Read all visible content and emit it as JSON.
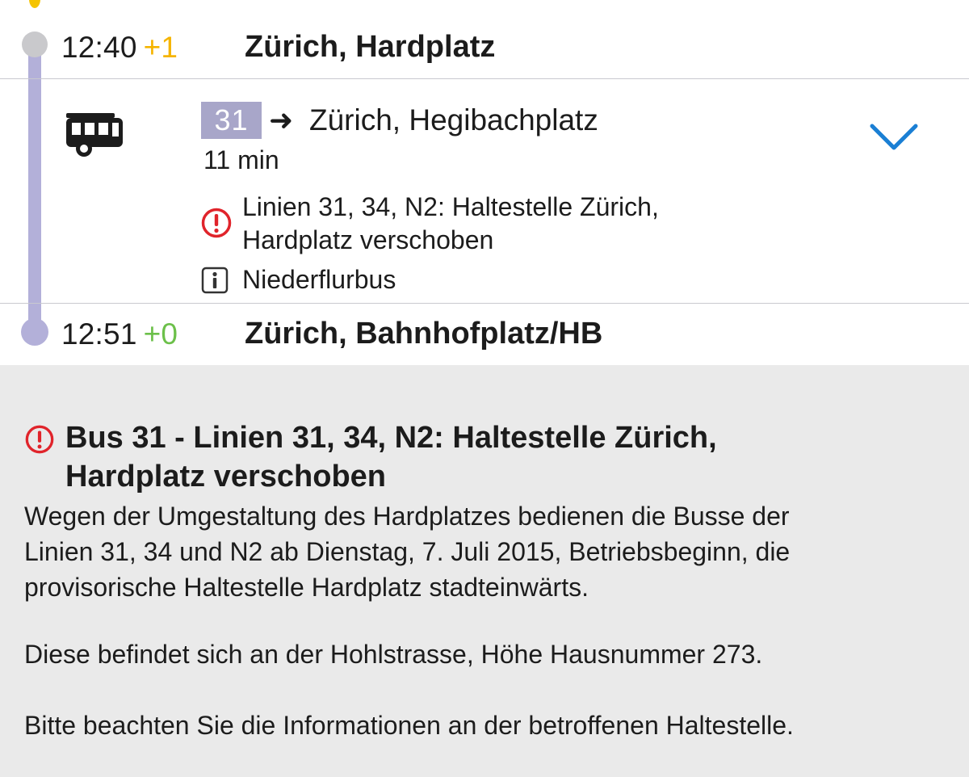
{
  "timeline": {
    "start": {
      "time": "12:40",
      "delay": "+1",
      "stop": "Zürich, Hardplatz"
    },
    "end": {
      "time": "12:51",
      "delay": "+0",
      "stop": "Zürich, Bahnhofplatz/HB"
    }
  },
  "journey": {
    "mode_icon": "bus-icon",
    "line": "31",
    "arrow": "➜",
    "destination": "Zürich, Hegibachplatz",
    "duration": "11 min",
    "notice_line1": "Linien 31, 34, N2: Haltestelle Zürich,",
    "notice_line2": "Hardplatz verschoben",
    "feature": "Niederflurbus",
    "expand_icon": "chevron-down-icon"
  },
  "detail": {
    "title_line1": "Bus 31 - Linien 31, 34, N2: Haltestelle Zürich,",
    "title_line2": "Hardplatz verschoben",
    "p1_line1": "Wegen der Umgestaltung des Hardplatzes bedienen die Busse der",
    "p1_line2": "Linien 31, 34 und N2 ab Dienstag, 7. Juli 2015, Betriebsbeginn, die",
    "p1_line3": "provisorische Haltestelle Hardplatz stadteinwärts.",
    "p2": "Diese befindet sich an der Hohlstrasse, Höhe Hausnummer 273.",
    "p3": "Bitte beachten Sie die Informationen an der betroffenen Haltestelle."
  },
  "colors": {
    "timeline": "#b3b0d9",
    "line_badge": "#a8a6c9",
    "delay_late": "#f5b400",
    "delay_ok": "#6cc04a",
    "warning": "#e0242b",
    "chevron": "#1a7fd4",
    "panel_bg": "#eaeaea"
  }
}
